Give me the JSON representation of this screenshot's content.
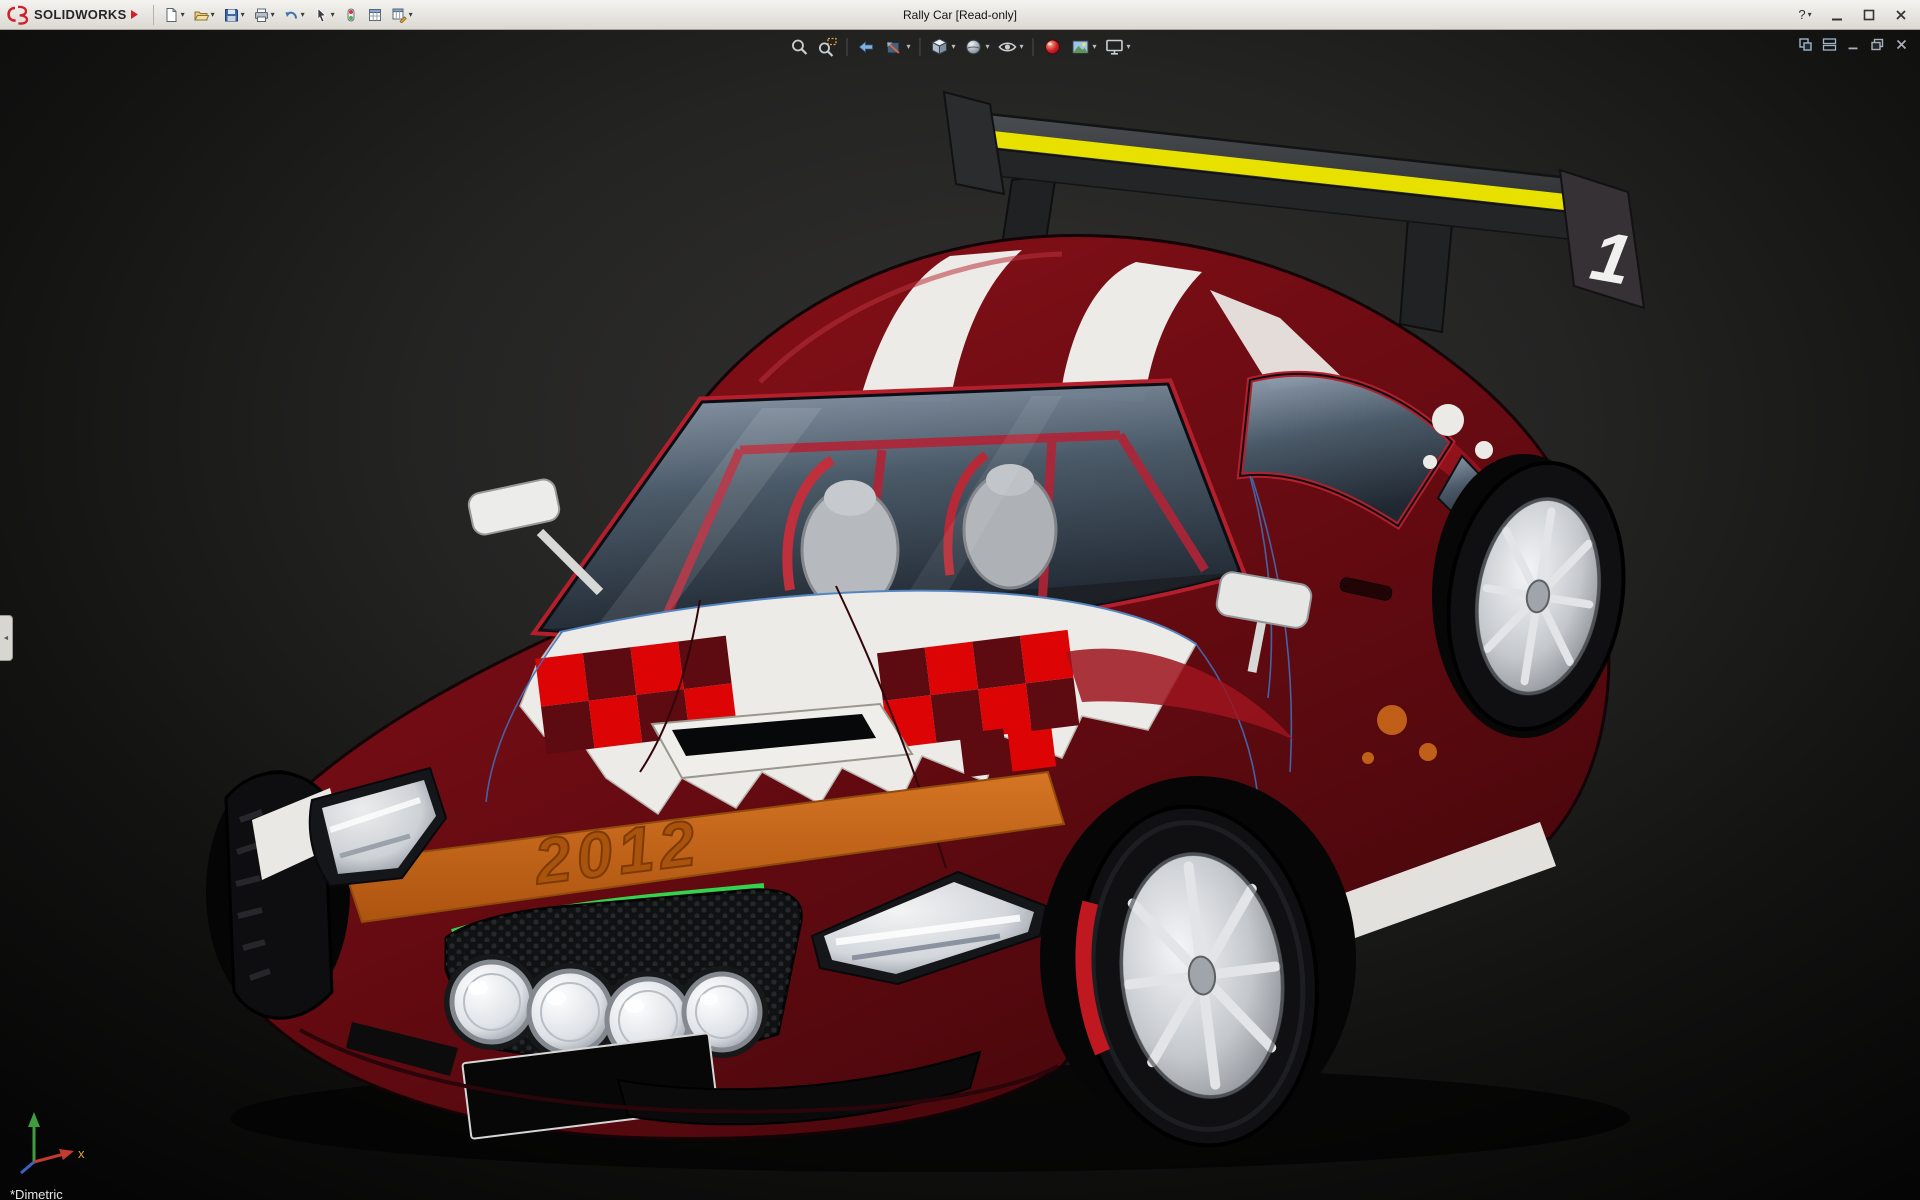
{
  "window": {
    "brand": "SOLIDWORKS",
    "title": "Rally Car [Read-only]",
    "controls": {
      "help": "?"
    }
  },
  "glyphs": {
    "caret_down": "▾",
    "collapse_left": "◄",
    "axis_x": "x"
  },
  "titlebar_tools": [
    "new-document",
    "open",
    "save",
    "print",
    "undo",
    "select",
    "rebuild",
    "file-properties",
    "options"
  ],
  "heads_up_toolbar": [
    "zoom-to-fit",
    "zoom-to-area",
    "previous-view",
    "section-view",
    "view-orientation",
    "display-style",
    "hide-show-items",
    "edit-appearance",
    "apply-scene",
    "view-settings"
  ],
  "document_window_controls": [
    "doc-windows",
    "doc-tile",
    "doc-minimize",
    "doc-restore",
    "doc-close"
  ],
  "viewport": {
    "orientation_label": "*Dimetric",
    "model": {
      "year_decal": "2012",
      "race_number": "1"
    }
  },
  "colors": {
    "body_red": "#7c0f16",
    "stripe_white": "#edebe7",
    "band_orange": "#c8651a",
    "wing_yellow": "#e8e100",
    "accent_green": "#35d24f",
    "checker_red": "#dc0405",
    "checker_maroon": "#5d0a10",
    "titlebar_bg": "#e9e6e0",
    "viewport_bg": "#1d1d1c"
  }
}
